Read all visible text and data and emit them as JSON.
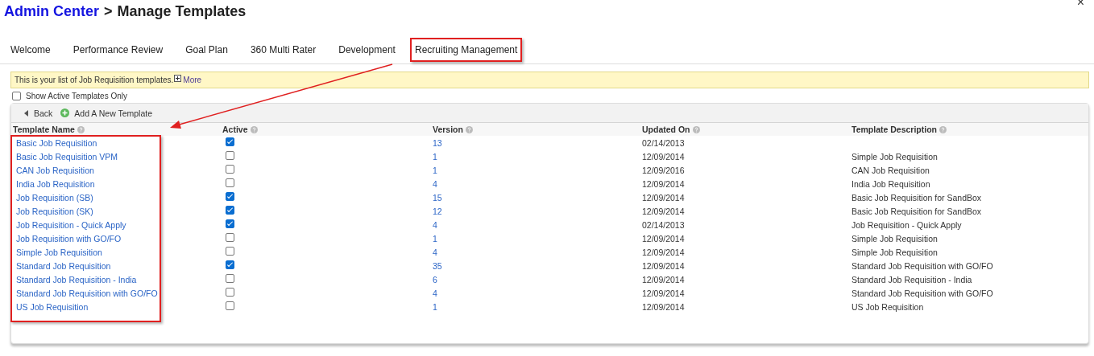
{
  "breadcrumb": {
    "link": "Admin Center",
    "separator": ">",
    "current": "Manage Templates"
  },
  "close_icon": "×",
  "tabs": [
    {
      "label": "Welcome",
      "selected": false,
      "boxed": false
    },
    {
      "label": "Performance Review",
      "selected": false,
      "boxed": false
    },
    {
      "label": "Goal Plan",
      "selected": false,
      "boxed": false
    },
    {
      "label": "360 Multi Rater",
      "selected": false,
      "boxed": false
    },
    {
      "label": "Development",
      "selected": false,
      "boxed": false
    },
    {
      "label": "Recruiting Management",
      "selected": false,
      "boxed": true
    }
  ],
  "info_bar": {
    "text": "This is your list of Job Requisition templates.",
    "more": "More"
  },
  "filter": {
    "label": "Show Active Templates Only",
    "checked": false
  },
  "toolbar": {
    "back": "Back",
    "add": "Add A New Template"
  },
  "table": {
    "columns": [
      "Template Name",
      "Active",
      "Version",
      "Updated On",
      "Template Description"
    ],
    "rows": [
      {
        "name": "Basic Job Requisition",
        "active": true,
        "version": "13",
        "updated": "02/14/2013"
      },
      {
        "name": "Basic Job Requisition VPM",
        "active": false,
        "version": "1",
        "updated": "12/09/2014",
        "description": "Simple Job Requisition"
      },
      {
        "name": "CAN Job Requisition",
        "active": false,
        "version": "1",
        "updated": "12/09/2016",
        "description": "CAN Job Requisition"
      },
      {
        "name": "India Job Requisition",
        "active": false,
        "version": "4",
        "updated": "12/09/2014",
        "description": "India Job Requisition"
      },
      {
        "name": "Job Requisition (SB)",
        "active": true,
        "version": "15",
        "updated": "12/09/2014",
        "description": "Basic Job Requisition for SandBox"
      },
      {
        "name": "Job Requisition (SK)",
        "active": true,
        "version": "12",
        "updated": "12/09/2014",
        "description": "Basic Job Requisition for SandBox"
      },
      {
        "name": "Job Requisition - Quick Apply",
        "active": true,
        "version": "4",
        "updated": "02/14/2013",
        "description": "Job Requisition - Quick Apply"
      },
      {
        "name": "Job Requisition with GO/FO",
        "active": false,
        "version": "1",
        "updated": "12/09/2014",
        "description": "Simple Job Requisition"
      },
      {
        "name": "Simple Job Requisition",
        "active": false,
        "version": "4",
        "updated": "12/09/2014",
        "description": "Simple Job Requisition"
      },
      {
        "name": "Standard Job Requisition",
        "active": true,
        "version": "35",
        "updated": "12/09/2014",
        "description": "Standard Job Requisition with GO/FO"
      },
      {
        "name": "Standard Job Requisition - India",
        "active": false,
        "version": "6",
        "updated": "12/09/2014",
        "description": "Standard Job Requisition - India"
      },
      {
        "name": "Standard Job Requisition with GO/FO",
        "active": false,
        "version": "4",
        "updated": "12/09/2014",
        "description": "Standard Job Requisition with GO/FO"
      },
      {
        "name": "US Job Requisition",
        "active": false,
        "version": "1",
        "updated": "12/09/2014",
        "description": "US Job Requisition"
      }
    ]
  }
}
